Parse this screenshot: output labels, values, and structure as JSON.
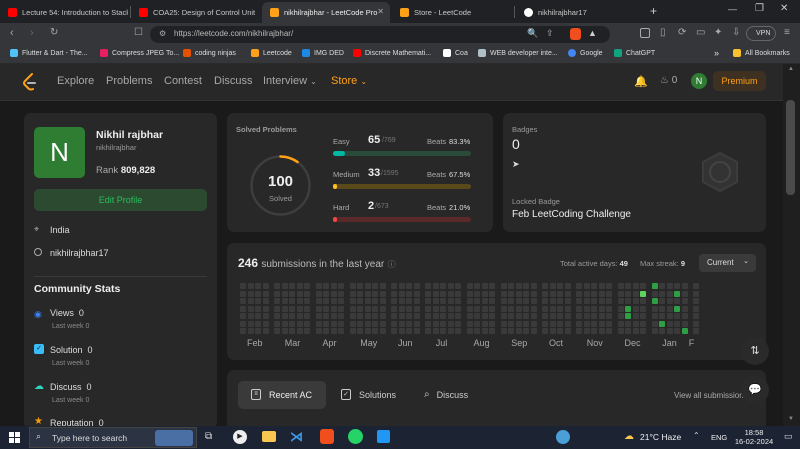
{
  "browser": {
    "tabs": [
      {
        "title": "Lecture 54: Introduction to Stack",
        "favicon_color": "#ff0000"
      },
      {
        "title": "COA25: Design of Control Unit |",
        "favicon_color": "#ff0000"
      },
      {
        "title": "nikhilrajbhar - LeetCode Pro",
        "favicon_color": "#ffa116"
      },
      {
        "title": "Store - LeetCode",
        "favicon_color": "#ffa116"
      },
      {
        "title": "nikhilrajbhar17",
        "favicon_color": "#ffffff"
      }
    ],
    "new_tab": "+",
    "url": "https://leetcode.com/nikhilrajbhar/",
    "vpn_label": "VPN",
    "bookmarks": [
      "Flutter & Dart - The...",
      "Compress JPEG To...",
      "coding ninjas",
      "Leetcode",
      "IMG DED",
      "Discrete Mathemati...",
      "Coa",
      "WEB developer inte...",
      "Google",
      "ChatGPT"
    ],
    "bookmarks_more": "»",
    "all_bookmarks": "All Bookmarks"
  },
  "nav": {
    "items": [
      "Explore",
      "Problems",
      "Contest",
      "Discuss",
      "Interview",
      "Store"
    ],
    "streak_count": "0",
    "avatar_letter": "N",
    "premium_label": "Premium"
  },
  "profile": {
    "avatar_letter": "N",
    "name": "Nikhil rajbhar",
    "username": "nikhilrajbhar",
    "rank_label": "Rank",
    "rank_value": "809,828",
    "edit_label": "Edit Profile",
    "location": "India",
    "github": "nikhilrajbhar17",
    "community_title": "Community Stats",
    "stats": [
      {
        "label": "Views",
        "value": "0",
        "sub_label": "Last week",
        "sub_value": "0",
        "color": "#3b82f6"
      },
      {
        "label": "Solution",
        "value": "0",
        "sub_label": "Last week",
        "sub_value": "0",
        "color": "#38bdf8"
      },
      {
        "label": "Discuss",
        "value": "0",
        "sub_label": "Last week",
        "sub_value": "0",
        "color": "#2dd4bf"
      },
      {
        "label": "Reputation",
        "value": "0",
        "sub_label": "",
        "sub_value": "",
        "color": "#f59e0b"
      }
    ]
  },
  "solved": {
    "title": "Solved Problems",
    "total": "100",
    "total_label": "Solved",
    "progress_fraction": 0.1,
    "rows": [
      {
        "label": "Easy",
        "count": "65",
        "total": "/769",
        "beats_label": "Beats",
        "beats": "83.3%",
        "fraction": 0.0845,
        "color": "#00b8a3",
        "track": "#2a4a3a"
      },
      {
        "label": "Medium",
        "count": "33",
        "total": "/1595",
        "beats_label": "Beats",
        "beats": "67.5%",
        "fraction": 0.0207,
        "color": "#ffc01e",
        "track": "#5a4a1a"
      },
      {
        "label": "Hard",
        "count": "2",
        "total": "/673",
        "beats_label": "Beats",
        "beats": "21.0%",
        "fraction": 0.003,
        "color": "#ef4743",
        "track": "#5a2a2a"
      }
    ]
  },
  "badges": {
    "title": "Badges",
    "count": "0",
    "locked_label": "Locked Badge",
    "locked_name": "Feb LeetCoding Challenge"
  },
  "submissions": {
    "count": "246",
    "text": "submissions in the last year",
    "active_days_label": "Total active days:",
    "active_days": "49",
    "max_streak_label": "Max streak:",
    "max_streak": "9",
    "period": "Current",
    "months": [
      "Feb",
      "Mar",
      "Apr",
      "May",
      "Jun",
      "Jul",
      "Aug",
      "Sep",
      "Oct",
      "Nov",
      "Dec",
      "Jan",
      "F"
    ]
  },
  "tabs": {
    "recent": "Recent AC",
    "solutions": "Solutions",
    "discuss": "Discuss",
    "view_all": "View all submissions"
  },
  "taskbar": {
    "search_placeholder": "Type here to search",
    "weather": "21°C  Haze",
    "lang": "ENG",
    "time": "18:58",
    "date": "16-02-2024"
  }
}
